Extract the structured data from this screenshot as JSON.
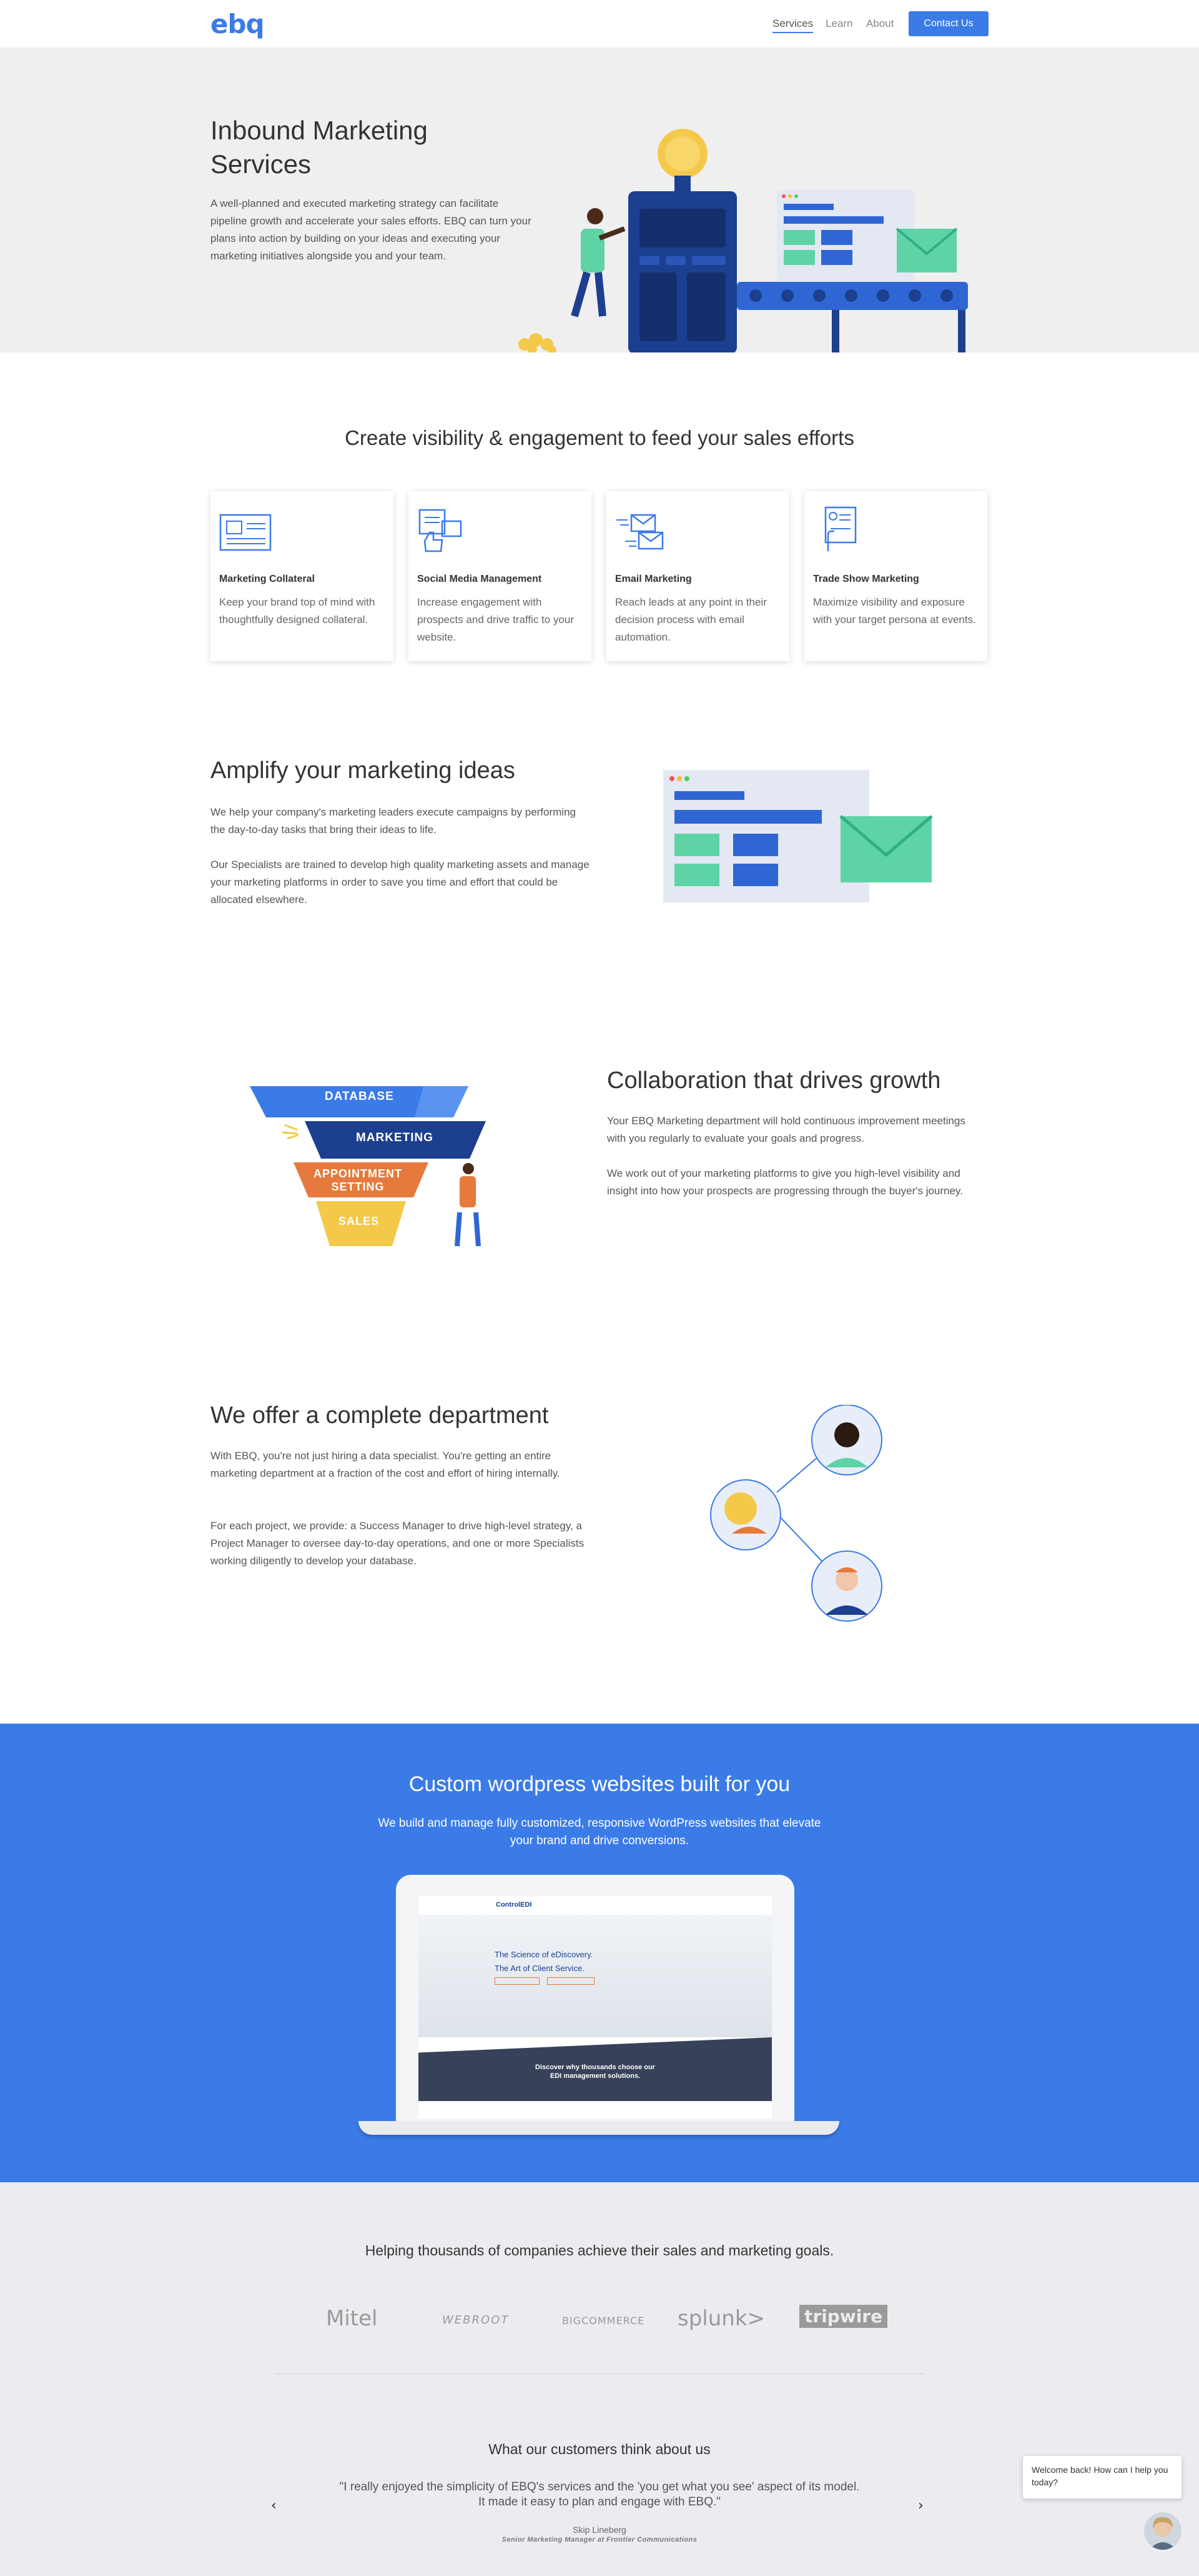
{
  "nav": {
    "logo": "ebq",
    "links": [
      "Services",
      "Learn",
      "About"
    ],
    "cta": "Contact Us"
  },
  "hero": {
    "title": "Inbound Marketing Services",
    "body": "A well-planned and executed marketing strategy can facilitate pipeline growth and accelerate your sales efforts. EBQ can turn your plans into action by building on your ideas and executing your marketing initiatives alongside you and your team."
  },
  "visibility": {
    "title": "Create visibility & engagement to feed your sales efforts",
    "cards": [
      {
        "title": "Marketing Collateral",
        "body": "Keep your brand top of mind with thoughtfully designed collateral.",
        "icon": "document-screen-icon"
      },
      {
        "title": "Social Media Management",
        "body": "Increase engagement with prospects and drive traffic to your website.",
        "icon": "social-thumbs-up-icon"
      },
      {
        "title": "Email Marketing",
        "body": "Reach leads at any point in their decision process with email automation.",
        "icon": "email-envelopes-icon"
      },
      {
        "title": "Trade Show Marketing",
        "body": "Maximize visibility and exposure with your target persona at events.",
        "icon": "trade-show-badge-icon"
      }
    ]
  },
  "amplify": {
    "title": "Amplify your marketing ideas",
    "p1": "We help your company's marketing leaders execute campaigns by performing the day-to-day tasks that bring their ideas to life.",
    "p2": "Our Specialists are trained to develop high quality marketing assets and manage your marketing platforms in order to save you time and effort that could be allocated elsewhere."
  },
  "collaboration": {
    "title": "Collaboration that drives growth",
    "p1": "Your EBQ Marketing department will hold continuous improvement meetings with you regularly to evaluate your goals and progress.",
    "p2": "We work out of your marketing platforms to give you high-level visibility and insight into how your prospects are progressing through the buyer's journey.",
    "funnel": [
      "DATABASE",
      "MARKETING",
      "APPOINTMENT SETTING",
      "SALES"
    ]
  },
  "department": {
    "title": "We offer a complete department",
    "p1": "With EBQ, you're not just hiring a data specialist. You're getting an entire marketing department at a fraction of the cost and effort of hiring internally.",
    "p2": "For each project, we provide: a Success Manager to drive high-level strategy, a Project Manager to oversee day-to-day operations, and one or more Specialists working diligently to develop your database."
  },
  "wordpress": {
    "title": "Custom wordpress websites built for you",
    "body": "We build and manage fully customized, responsive WordPress websites that elevate your brand and drive conversions.",
    "screen": {
      "brand": "ControlEDI",
      "line1": "The Science of eDiscovery.",
      "line2": "The Art of Client Service.",
      "banner1": "Discover why thousands choose our",
      "banner2": "EDI management solutions."
    }
  },
  "clients": {
    "title": "Helping thousands of companies achieve their sales and marketing goals.",
    "logos": [
      "Mitel",
      "WEBROOT",
      "BIGCOMMERCE",
      "splunk>",
      "tripwire"
    ],
    "testimonial_title": "What our customers think about us",
    "quote": "\"I really enjoyed the simplicity of EBQ's services and the 'you get what you see' aspect of its model. It made it easy to plan and engage with EBQ.\"",
    "name": "Skip Lineberg",
    "role": "Senior Marketing Manager at Frontier Communications",
    "prev": "‹",
    "next": "›"
  },
  "chat": {
    "message": "Welcome back! How can I help you today?"
  },
  "colors": {
    "primary": "#3b7be8",
    "navy": "#1d3f8f",
    "green": "#5ed3a6",
    "orange": "#e57a3c",
    "yellow": "#f4c94a"
  }
}
